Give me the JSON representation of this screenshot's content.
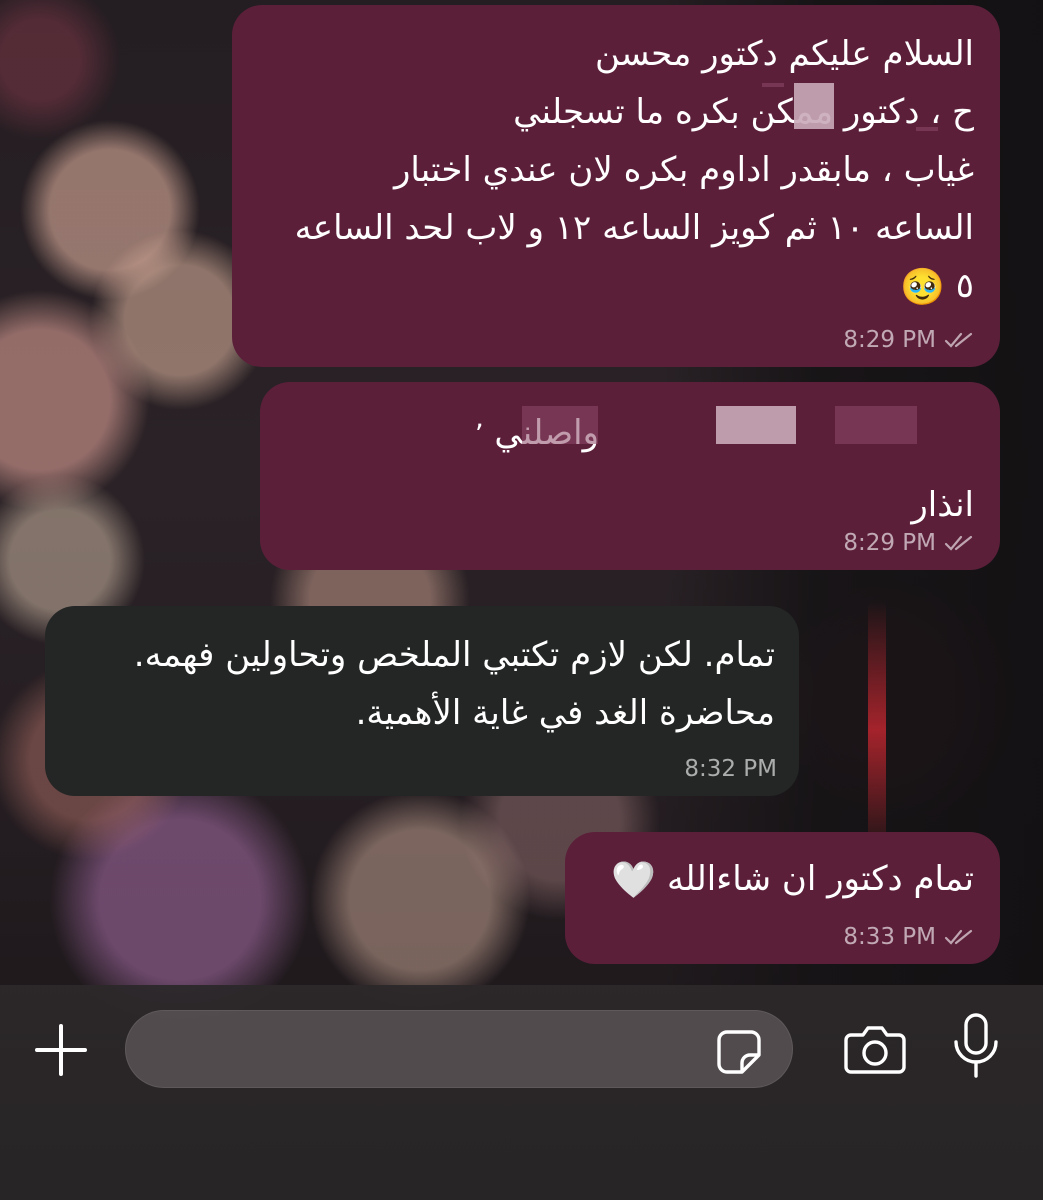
{
  "messages": [
    {
      "direction": "outgoing",
      "lines": [
        "السلام عليكم دكتور محسن",
        "ح ، دكتور ممكن بكره ما تسجلني",
        "غياب ، مابقدر اداوم بكره لان عندي اختبار",
        "الساعه ١٠ ثم كويز الساعه ١٢ و لاب لحد الساعه",
        "٥"
      ],
      "emoji": "🥹",
      "time": "8:29 PM",
      "status": "read"
    },
    {
      "direction": "outgoing",
      "lines": [
        "واصلني",
        "انذار"
      ],
      "time": "8:29 PM",
      "status": "read"
    },
    {
      "direction": "incoming",
      "lines": [
        "تمام. لكن لازم تكتبي الملخص وتحاولين فهمه.",
        "محاضرة الغد في غاية الأهمية."
      ],
      "time": "8:32 PM"
    },
    {
      "direction": "outgoing",
      "lines": [
        "تمام دكتور ان شاءالله"
      ],
      "emoji": "🤍",
      "time": "8:33 PM",
      "status": "read"
    }
  ],
  "composer": {
    "placeholder": "",
    "value": "",
    "icons": [
      "plus-icon",
      "sticker-icon",
      "camera-icon",
      "microphone-icon"
    ]
  },
  "colors": {
    "outgoing_bubble": "#5c1f3a",
    "incoming_bubble": "#232625",
    "meta_text": "#b9b2b5"
  }
}
